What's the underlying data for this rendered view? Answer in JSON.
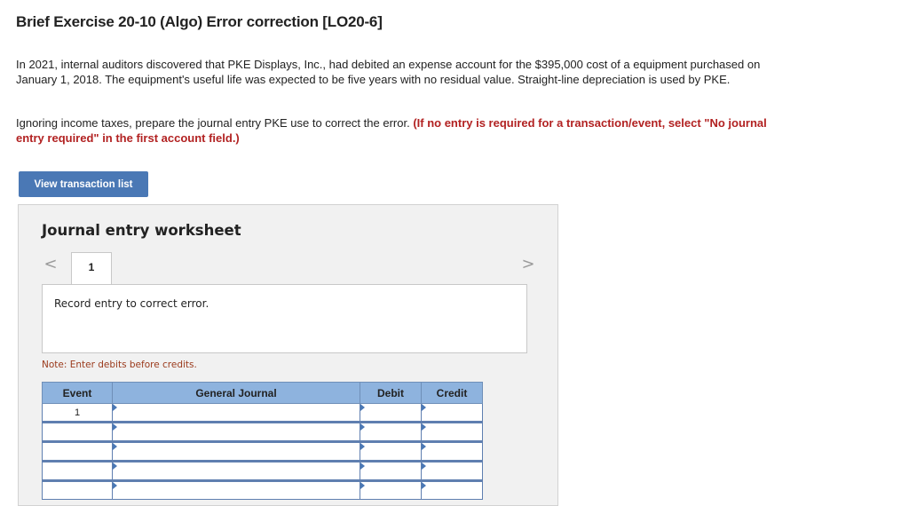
{
  "header": {
    "title": "Brief Exercise 20-10 (Algo) Error correction [LO20-6]"
  },
  "problem": {
    "paragraph": "In 2021, internal auditors discovered that PKE Displays, Inc., had debited an expense account for the $395,000 cost of a equipment purchased on January 1, 2018. The equipment's useful life was expected to be five years with no residual value. Straight-line depreciation is used by PKE.",
    "instruction": "Ignoring income taxes, prepare the journal entry PKE use to correct the error.",
    "instruction_emphasis": "(If no entry is required for a transaction/event, select \"No journal entry required\" in the first account field.)"
  },
  "buttons": {
    "view_transaction_list": "View transaction list"
  },
  "worksheet": {
    "title": "Journal entry worksheet",
    "nav_prev": "<",
    "nav_next": ">",
    "tabs": [
      "1"
    ],
    "instruction": "Record entry to correct error.",
    "note": "Note: Enter debits before credits.",
    "columns": {
      "event": "Event",
      "general_journal": "General Journal",
      "debit": "Debit",
      "credit": "Credit"
    },
    "rows": [
      {
        "event": "1",
        "account": "",
        "debit": "",
        "credit": ""
      },
      {
        "event": "",
        "account": "",
        "debit": "",
        "credit": ""
      },
      {
        "event": "",
        "account": "",
        "debit": "",
        "credit": ""
      },
      {
        "event": "",
        "account": "",
        "debit": "",
        "credit": ""
      },
      {
        "event": "",
        "account": "",
        "debit": "",
        "credit": ""
      }
    ]
  },
  "colors": {
    "accent": "#4a78b5",
    "header_fill": "#8eb3de",
    "emphasis_text": "#b22222",
    "note_text": "#9b3a1c"
  }
}
